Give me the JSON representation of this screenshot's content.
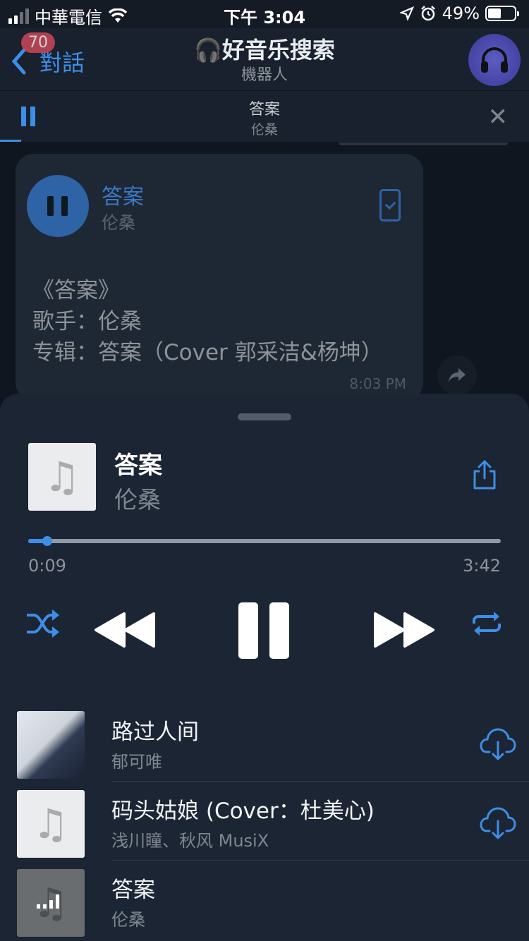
{
  "status_bar": {
    "carrier": "中華電信",
    "time": "下午 3:04",
    "battery": "49%",
    "battery_level": 0.49
  },
  "nav": {
    "back_label": "對話",
    "badge": "70",
    "title": "🎧好音乐搜索",
    "subtitle": "機器人"
  },
  "mini_player": {
    "title": "答案",
    "artist": "伦桑",
    "progress": 0.04
  },
  "message": {
    "song": "答案",
    "artist": "伦桑",
    "caption_line1": "《答案》",
    "caption_line2": "歌手：伦桑",
    "caption_line3": "专辑：答案（Cover 郭采洁&杨坤）",
    "time": "8:03 PM"
  },
  "player": {
    "title": "答案",
    "artist": "伦桑",
    "elapsed": "0:09",
    "duration": "3:42",
    "progress": 0.04
  },
  "playlist": [
    {
      "title": "路过人间",
      "artist": "郁可唯",
      "thumb": "photo",
      "downloadable": true
    },
    {
      "title": "码头姑娘 (Cover：杜美心)",
      "artist": "浅川瞳、秋风 MusiX",
      "thumb": "note",
      "downloadable": true
    },
    {
      "title": "答案",
      "artist": "伦桑",
      "thumb": "playing",
      "downloadable": false
    }
  ],
  "colors": {
    "accent": "#3d8ee8",
    "background": "#141b25",
    "sheet": "#1c2533"
  }
}
